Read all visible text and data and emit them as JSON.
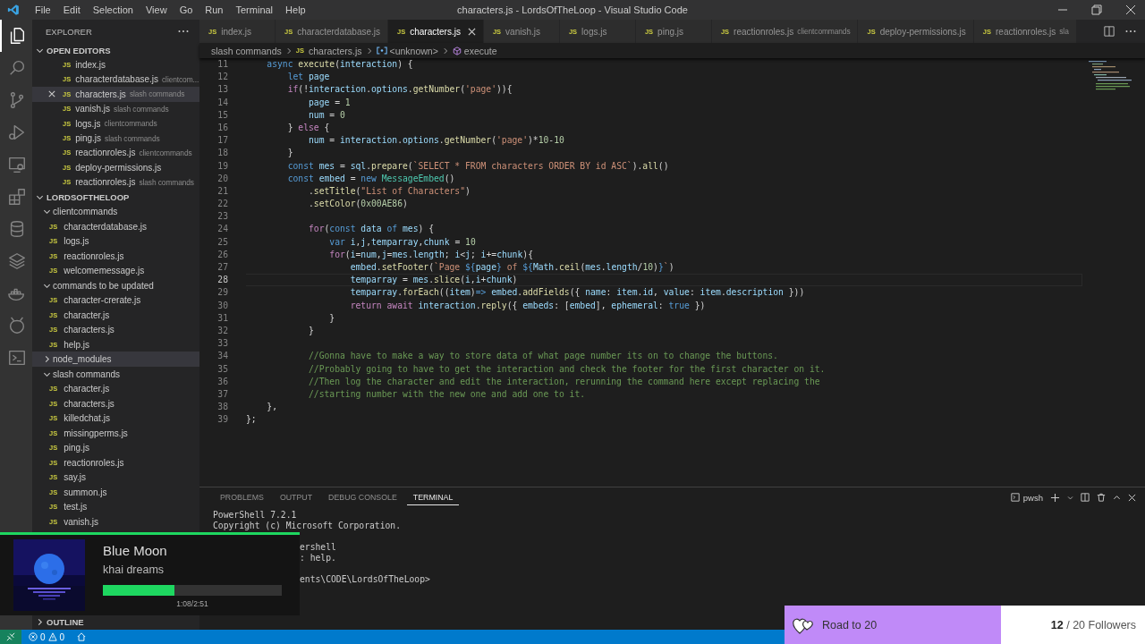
{
  "window": {
    "title": "characters.js - LordsOfTheLoop - Visual Studio Code"
  },
  "menu": [
    "File",
    "Edit",
    "Selection",
    "View",
    "Go",
    "Run",
    "Terminal",
    "Help"
  ],
  "activity_bar": [
    {
      "kind": "files",
      "selected": true
    },
    {
      "kind": "search",
      "selected": false
    },
    {
      "kind": "branch",
      "selected": false
    },
    {
      "kind": "debug",
      "selected": false
    },
    {
      "kind": "remote",
      "selected": false
    },
    {
      "kind": "extensions",
      "selected": false
    },
    {
      "kind": "database",
      "selected": false
    },
    {
      "kind": "layers",
      "selected": false
    },
    {
      "kind": "whale",
      "selected": false
    },
    {
      "kind": "antenna",
      "selected": false
    },
    {
      "kind": "terminal",
      "selected": false
    }
  ],
  "sidebar": {
    "title": "EXPLORER",
    "open_editors": {
      "title": "OPEN EDITORS",
      "expanded": true,
      "items": [
        {
          "icon": "JS",
          "name": "index.js",
          "selected": false
        },
        {
          "icon": "JS",
          "name": "characterdatabase.js",
          "folder": "clientcom...",
          "selected": false
        },
        {
          "icon": "JS",
          "name": "characters.js",
          "folder": "slash commands",
          "selected": true
        },
        {
          "icon": "JS",
          "name": "vanish.js",
          "folder": "slash commands",
          "selected": false
        },
        {
          "icon": "JS",
          "name": "logs.js",
          "folder": "clientcommands",
          "selected": false
        },
        {
          "icon": "JS",
          "name": "ping.js",
          "folder": "slash commands",
          "selected": false
        },
        {
          "icon": "JS",
          "name": "reactionroles.js",
          "folder": "clientcommands",
          "selected": false
        },
        {
          "icon": "JS",
          "name": "deploy-permissions.js",
          "selected": false
        },
        {
          "icon": "JS",
          "name": "reactionroles.js",
          "folder": "slash commands",
          "selected": false
        }
      ]
    },
    "project": {
      "title": "LORDSOFTHELOOP",
      "expanded": true,
      "children": [
        {
          "kind": "folder",
          "name": "clientcommands",
          "expanded": true,
          "selected": false,
          "children": [
            {
              "kind": "file",
              "icon": "JS",
              "name": "characterdatabase.js",
              "selected": false
            },
            {
              "kind": "file",
              "icon": "JS",
              "name": "logs.js",
              "selected": false
            },
            {
              "kind": "file",
              "icon": "JS",
              "name": "reactionroles.js",
              "selected": false
            },
            {
              "kind": "file",
              "icon": "JS",
              "name": "welcomemessage.js",
              "selected": false
            }
          ]
        },
        {
          "kind": "folder",
          "name": "commands to be updated",
          "expanded": true,
          "selected": false,
          "children": [
            {
              "kind": "file",
              "icon": "JS",
              "name": "character-crerate.js",
              "selected": false
            },
            {
              "kind": "file",
              "icon": "JS",
              "name": "character.js",
              "selected": false
            },
            {
              "kind": "file",
              "icon": "JS",
              "name": "characters.js",
              "selected": false
            },
            {
              "kind": "file",
              "icon": "JS",
              "name": "help.js",
              "selected": false
            }
          ]
        },
        {
          "kind": "folder",
          "name": "node_modules",
          "expanded": false,
          "selected": true
        },
        {
          "kind": "folder",
          "name": "slash commands",
          "expanded": true,
          "selected": false,
          "children": [
            {
              "kind": "file",
              "icon": "JS",
              "name": "character.js",
              "selected": false
            },
            {
              "kind": "file",
              "icon": "JS",
              "name": "characters.js",
              "selected": false
            },
            {
              "kind": "file",
              "icon": "JS",
              "name": "killedchat.js",
              "selected": false
            },
            {
              "kind": "file",
              "icon": "JS",
              "name": "missingperms.js",
              "selected": false
            },
            {
              "kind": "file",
              "icon": "JS",
              "name": "ping.js",
              "selected": false
            },
            {
              "kind": "file",
              "icon": "JS",
              "name": "reactionroles.js",
              "selected": false
            },
            {
              "kind": "file",
              "icon": "JS",
              "name": "say.js",
              "selected": false
            },
            {
              "kind": "file",
              "icon": "JS",
              "name": "summon.js",
              "selected": false
            },
            {
              "kind": "file",
              "icon": "JS",
              "name": "test.js",
              "selected": false
            },
            {
              "kind": "file",
              "icon": "JS",
              "name": "vanish.js",
              "selected": false
            }
          ]
        }
      ]
    },
    "outline": {
      "title": "OUTLINE",
      "expanded": false
    }
  },
  "tabs": [
    {
      "icon": "JS",
      "label": "index.js",
      "selected": false
    },
    {
      "icon": "JS",
      "label": "characterdatabase.js",
      "selected": false
    },
    {
      "icon": "JS",
      "label": "characters.js",
      "selected": true
    },
    {
      "icon": "JS",
      "label": "vanish.js",
      "selected": false
    },
    {
      "icon": "JS",
      "label": "logs.js",
      "selected": false
    },
    {
      "icon": "JS",
      "label": "ping.js",
      "selected": false
    },
    {
      "icon": "JS",
      "label": "reactionroles.js",
      "description": "clientcommands",
      "selected": false
    },
    {
      "icon": "JS",
      "label": "deploy-permissions.js",
      "selected": false
    },
    {
      "icon": "JS",
      "label": "reactionroles.js",
      "description": "sla",
      "selected": false
    }
  ],
  "breadcrumb": [
    {
      "kind": "folder",
      "label": "slash commands"
    },
    {
      "kind": "file",
      "icon": "JS",
      "label": "characters.js"
    },
    {
      "kind": "module",
      "label": "<unknown>"
    },
    {
      "kind": "method",
      "label": "execute"
    }
  ],
  "code": [
    {
      "number": "11",
      "current": false,
      "tokens": [
        {
          "kind": "kw",
          "text": "    async"
        },
        {
          "kind": "fn",
          "text": " execute"
        },
        {
          "kind": "p",
          "text": "("
        },
        {
          "kind": "var",
          "text": "interaction"
        },
        {
          "kind": "p",
          "text": ") {"
        }
      ]
    },
    {
      "number": "12",
      "current": false,
      "tokens": [
        {
          "kind": "kw",
          "text": "        let"
        },
        {
          "kind": "var",
          "text": " page"
        }
      ]
    },
    {
      "number": "13",
      "current": false,
      "tokens": [
        {
          "kind": "ctl",
          "text": "        if"
        },
        {
          "kind": "p",
          "text": "(!"
        },
        {
          "kind": "var",
          "text": "interaction"
        },
        {
          "kind": "p",
          "text": "."
        },
        {
          "kind": "var",
          "text": "options"
        },
        {
          "kind": "p",
          "text": "."
        },
        {
          "kind": "fn",
          "text": "getNumber"
        },
        {
          "kind": "p",
          "text": "("
        },
        {
          "kind": "str",
          "text": "'page'"
        },
        {
          "kind": "p",
          "text": ")){"
        }
      ]
    },
    {
      "number": "14",
      "current": false,
      "tokens": [
        {
          "kind": "var",
          "text": "            page"
        },
        {
          "kind": "p",
          "text": " = "
        },
        {
          "kind": "num",
          "text": "1"
        }
      ]
    },
    {
      "number": "15",
      "current": false,
      "tokens": [
        {
          "kind": "var",
          "text": "            num"
        },
        {
          "kind": "p",
          "text": " = "
        },
        {
          "kind": "num",
          "text": "0"
        }
      ]
    },
    {
      "number": "16",
      "current": false,
      "tokens": [
        {
          "kind": "p",
          "text": "        } "
        },
        {
          "kind": "ctl",
          "text": "else"
        },
        {
          "kind": "p",
          "text": " {"
        }
      ]
    },
    {
      "number": "17",
      "current": false,
      "tokens": [
        {
          "kind": "var",
          "text": "            num"
        },
        {
          "kind": "p",
          "text": " = "
        },
        {
          "kind": "var",
          "text": "interaction"
        },
        {
          "kind": "p",
          "text": "."
        },
        {
          "kind": "var",
          "text": "options"
        },
        {
          "kind": "p",
          "text": "."
        },
        {
          "kind": "fn",
          "text": "getNumber"
        },
        {
          "kind": "p",
          "text": "("
        },
        {
          "kind": "str",
          "text": "'page'"
        },
        {
          "kind": "p",
          "text": ")*"
        },
        {
          "kind": "num",
          "text": "10"
        },
        {
          "kind": "p",
          "text": "-"
        },
        {
          "kind": "num",
          "text": "10"
        }
      ]
    },
    {
      "number": "18",
      "current": false,
      "tokens": [
        {
          "kind": "p",
          "text": "        }"
        }
      ]
    },
    {
      "number": "19",
      "current": false,
      "tokens": [
        {
          "kind": "kw",
          "text": "        const"
        },
        {
          "kind": "var",
          "text": " mes"
        },
        {
          "kind": "p",
          "text": " = "
        },
        {
          "kind": "var",
          "text": "sql"
        },
        {
          "kind": "p",
          "text": "."
        },
        {
          "kind": "fn",
          "text": "prepare"
        },
        {
          "kind": "p",
          "text": "("
        },
        {
          "kind": "str",
          "text": "`SELECT * FROM characters ORDER BY id ASC`"
        },
        {
          "kind": "p",
          "text": ")."
        },
        {
          "kind": "fn",
          "text": "all"
        },
        {
          "kind": "p",
          "text": "()"
        }
      ]
    },
    {
      "number": "20",
      "current": false,
      "tokens": [
        {
          "kind": "kw",
          "text": "        const"
        },
        {
          "kind": "var",
          "text": " embed"
        },
        {
          "kind": "p",
          "text": " = "
        },
        {
          "kind": "kw",
          "text": "new"
        },
        {
          "kind": "type",
          "text": " MessageEmbed"
        },
        {
          "kind": "p",
          "text": "()"
        }
      ]
    },
    {
      "number": "21",
      "current": false,
      "tokens": [
        {
          "kind": "p",
          "text": "            ."
        },
        {
          "kind": "fn",
          "text": "setTitle"
        },
        {
          "kind": "p",
          "text": "("
        },
        {
          "kind": "str",
          "text": "\"List of Characters\""
        },
        {
          "kind": "p",
          "text": ")"
        }
      ]
    },
    {
      "number": "22",
      "current": false,
      "tokens": [
        {
          "kind": "p",
          "text": "            ."
        },
        {
          "kind": "fn",
          "text": "setColor"
        },
        {
          "kind": "p",
          "text": "("
        },
        {
          "kind": "num",
          "text": "0x00AE86"
        },
        {
          "kind": "p",
          "text": ")"
        }
      ]
    },
    {
      "number": "23",
      "current": false
    },
    {
      "number": "24",
      "current": false,
      "tokens": [
        {
          "kind": "ctl",
          "text": "            for"
        },
        {
          "kind": "p",
          "text": "("
        },
        {
          "kind": "kw",
          "text": "const"
        },
        {
          "kind": "var",
          "text": " data"
        },
        {
          "kind": "kw",
          "text": " of"
        },
        {
          "kind": "var",
          "text": " mes"
        },
        {
          "kind": "p",
          "text": ") {"
        }
      ]
    },
    {
      "number": "25",
      "current": false,
      "tokens": [
        {
          "kind": "kw",
          "text": "                var"
        },
        {
          "kind": "var",
          "text": " i"
        },
        {
          "kind": "p",
          "text": ","
        },
        {
          "kind": "var",
          "text": "j"
        },
        {
          "kind": "p",
          "text": ","
        },
        {
          "kind": "var",
          "text": "temparray"
        },
        {
          "kind": "p",
          "text": ","
        },
        {
          "kind": "var",
          "text": "chunk"
        },
        {
          "kind": "p",
          "text": " = "
        },
        {
          "kind": "num",
          "text": "10"
        }
      ]
    },
    {
      "number": "26",
      "current": false,
      "tokens": [
        {
          "kind": "ctl",
          "text": "                for"
        },
        {
          "kind": "p",
          "text": "("
        },
        {
          "kind": "var",
          "text": "i"
        },
        {
          "kind": "p",
          "text": "="
        },
        {
          "kind": "var",
          "text": "num"
        },
        {
          "kind": "p",
          "text": ","
        },
        {
          "kind": "var",
          "text": "j"
        },
        {
          "kind": "p",
          "text": "="
        },
        {
          "kind": "var",
          "text": "mes"
        },
        {
          "kind": "p",
          "text": "."
        },
        {
          "kind": "var",
          "text": "length"
        },
        {
          "kind": "p",
          "text": "; "
        },
        {
          "kind": "var",
          "text": "i"
        },
        {
          "kind": "p",
          "text": "<"
        },
        {
          "kind": "var",
          "text": "j"
        },
        {
          "kind": "p",
          "text": "; "
        },
        {
          "kind": "var",
          "text": "i"
        },
        {
          "kind": "p",
          "text": "+="
        },
        {
          "kind": "var",
          "text": "chunk"
        },
        {
          "kind": "p",
          "text": "){"
        }
      ]
    },
    {
      "number": "27",
      "current": false,
      "tokens": [
        {
          "kind": "var",
          "text": "                    embed"
        },
        {
          "kind": "p",
          "text": "."
        },
        {
          "kind": "fn",
          "text": "setFooter"
        },
        {
          "kind": "p",
          "text": "("
        },
        {
          "kind": "str",
          "text": "`Page "
        },
        {
          "kind": "kw",
          "text": "${"
        },
        {
          "kind": "var",
          "text": "page"
        },
        {
          "kind": "kw",
          "text": "}"
        },
        {
          "kind": "str",
          "text": " of "
        },
        {
          "kind": "kw",
          "text": "${"
        },
        {
          "kind": "var",
          "text": "Math"
        },
        {
          "kind": "p",
          "text": "."
        },
        {
          "kind": "fn",
          "text": "ceil"
        },
        {
          "kind": "p",
          "text": "("
        },
        {
          "kind": "var",
          "text": "mes"
        },
        {
          "kind": "p",
          "text": "."
        },
        {
          "kind": "var",
          "text": "length"
        },
        {
          "kind": "p",
          "text": "/"
        },
        {
          "kind": "num",
          "text": "10"
        },
        {
          "kind": "p",
          "text": ")"
        },
        {
          "kind": "kw",
          "text": "}"
        },
        {
          "kind": "str",
          "text": "`"
        },
        {
          "kind": "p",
          "text": ")"
        }
      ]
    },
    {
      "number": "28",
      "current": true,
      "tokens": [
        {
          "kind": "var",
          "text": "                    temparray"
        },
        {
          "kind": "p",
          "text": " = "
        },
        {
          "kind": "var",
          "text": "mes"
        },
        {
          "kind": "p",
          "text": "."
        },
        {
          "kind": "fn",
          "text": "slice"
        },
        {
          "kind": "p",
          "text": "("
        },
        {
          "kind": "var",
          "text": "i"
        },
        {
          "kind": "p",
          "text": ","
        },
        {
          "kind": "var",
          "text": "i"
        },
        {
          "kind": "p",
          "text": "+"
        },
        {
          "kind": "var",
          "text": "chunk"
        },
        {
          "kind": "p",
          "text": ")"
        }
      ]
    },
    {
      "number": "29",
      "current": false,
      "tokens": [
        {
          "kind": "var",
          "text": "                    temparray"
        },
        {
          "kind": "p",
          "text": "."
        },
        {
          "kind": "fn",
          "text": "forEach"
        },
        {
          "kind": "p",
          "text": "(("
        },
        {
          "kind": "var",
          "text": "item"
        },
        {
          "kind": "p",
          "text": ")"
        },
        {
          "kind": "kw",
          "text": "=>"
        },
        {
          "kind": "var",
          "text": " embed"
        },
        {
          "kind": "p",
          "text": "."
        },
        {
          "kind": "fn",
          "text": "addFields"
        },
        {
          "kind": "p",
          "text": "({ "
        },
        {
          "kind": "var",
          "text": "name"
        },
        {
          "kind": "p",
          "text": ": "
        },
        {
          "kind": "var",
          "text": "item"
        },
        {
          "kind": "p",
          "text": "."
        },
        {
          "kind": "var",
          "text": "id"
        },
        {
          "kind": "p",
          "text": ", "
        },
        {
          "kind": "var",
          "text": "value"
        },
        {
          "kind": "p",
          "text": ": "
        },
        {
          "kind": "var",
          "text": "item"
        },
        {
          "kind": "p",
          "text": "."
        },
        {
          "kind": "var",
          "text": "description"
        },
        {
          "kind": "p",
          "text": " }))"
        }
      ]
    },
    {
      "number": "30",
      "current": false,
      "tokens": [
        {
          "kind": "ctl",
          "text": "                    return"
        },
        {
          "kind": "ctl",
          "text": " await"
        },
        {
          "kind": "var",
          "text": " interaction"
        },
        {
          "kind": "p",
          "text": "."
        },
        {
          "kind": "fn",
          "text": "reply"
        },
        {
          "kind": "p",
          "text": "({ "
        },
        {
          "kind": "var",
          "text": "embeds"
        },
        {
          "kind": "p",
          "text": ": ["
        },
        {
          "kind": "var",
          "text": "embed"
        },
        {
          "kind": "p",
          "text": "], "
        },
        {
          "kind": "var",
          "text": "ephemeral"
        },
        {
          "kind": "p",
          "text": ": "
        },
        {
          "kind": "kw",
          "text": "true"
        },
        {
          "kind": "p",
          "text": " })"
        }
      ]
    },
    {
      "number": "31",
      "current": false,
      "tokens": [
        {
          "kind": "p",
          "text": "                }"
        }
      ]
    },
    {
      "number": "32",
      "current": false,
      "tokens": [
        {
          "kind": "p",
          "text": "            }"
        }
      ]
    },
    {
      "number": "33",
      "current": false
    },
    {
      "number": "34",
      "current": false,
      "tokens": [
        {
          "kind": "cm",
          "text": "            //Gonna have to make a way to store data of what page number its on to change the buttons."
        }
      ]
    },
    {
      "number": "35",
      "current": false,
      "tokens": [
        {
          "kind": "cm",
          "text": "            //Probably going to have to get the interaction and check the footer for the first character on it."
        }
      ]
    },
    {
      "number": "36",
      "current": false,
      "tokens": [
        {
          "kind": "cm",
          "text": "            //Then log the character and edit the interaction, rerunning the command here except replacing the"
        }
      ]
    },
    {
      "number": "37",
      "current": false,
      "tokens": [
        {
          "kind": "cm",
          "text": "            //starting number with the new one and add one to it."
        }
      ]
    },
    {
      "number": "38",
      "current": false,
      "tokens": [
        {
          "kind": "p",
          "text": "    },"
        }
      ]
    },
    {
      "number": "39",
      "current": false,
      "tokens": [
        {
          "kind": "p",
          "text": "};"
        }
      ]
    }
  ],
  "panel": {
    "tabs": [
      {
        "label": "PROBLEMS",
        "selected": false
      },
      {
        "label": "OUTPUT",
        "selected": false
      },
      {
        "label": "DEBUG CONSOLE",
        "selected": false
      },
      {
        "label": "TERMINAL",
        "selected": true
      }
    ],
    "shell": "pwsh",
    "terminal": [
      {
        "kind": "full",
        "text": "PowerShell 7.2.1"
      },
      {
        "kind": "full",
        "text": "Copyright (c) Microsoft Corporation."
      },
      {
        "kind": "blank"
      },
      {
        "kind": "clipped",
        "text": "ershell"
      },
      {
        "kind": "clipped",
        "text": ": help."
      },
      {
        "kind": "blank"
      },
      {
        "kind": "clipped",
        "text": "ents\\CODE\\LordsOfTheLoop>"
      }
    ]
  },
  "status_bar": {
    "errors": "0",
    "warnings": "0"
  },
  "now_playing": {
    "title": "Blue Moon",
    "artist": "khai dreams",
    "level": 0.4,
    "time": "1:08/2:51"
  },
  "follower_goal": {
    "label": "Road to 20",
    "count": "**12** / 20 Followers",
    "level": 0.6
  }
}
